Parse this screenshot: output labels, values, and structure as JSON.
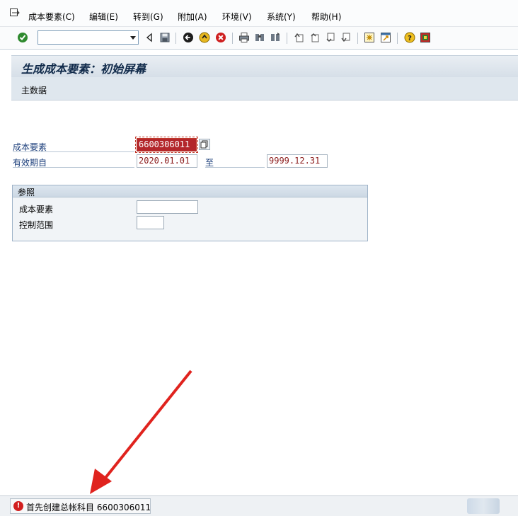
{
  "menu": {
    "items": [
      "成本要素(C)",
      "编辑(E)",
      "转到(G)",
      "附加(A)",
      "环境(V)",
      "系统(Y)",
      "帮助(H)"
    ]
  },
  "toolbar": {
    "command_value": "",
    "icons": [
      "enter-icon",
      "back-icon",
      "save-icon",
      "back-green-icon",
      "exit-icon",
      "cancel-icon",
      "print-icon",
      "find-icon",
      "find-next-icon",
      "first-page-icon",
      "prev-page-icon",
      "next-page-icon",
      "last-page-icon",
      "create-session-icon",
      "shortcut-icon",
      "help-icon",
      "layout-icon"
    ]
  },
  "title": "生成成本要素：初始屏幕",
  "appbar": {
    "button": "主数据"
  },
  "form": {
    "cost_element_label": "成本要素",
    "cost_element_value": "6600306011",
    "valid_from_label": "有效期自",
    "valid_from_value": "2020.01.01",
    "to_label": "至",
    "valid_to_value": "9999.12.31"
  },
  "reference": {
    "title": "参照",
    "cost_element_label": "成本要素",
    "cost_element_value": "",
    "controlling_area_label": "控制范围",
    "controlling_area_value": ""
  },
  "status": {
    "type": "error",
    "icon": "!",
    "message": "首先创建总帐科目 6600306011"
  },
  "colors": {
    "selected_field": "#b3262b",
    "arrow": "#e0231e",
    "label_blue": "#1a3d7a"
  }
}
